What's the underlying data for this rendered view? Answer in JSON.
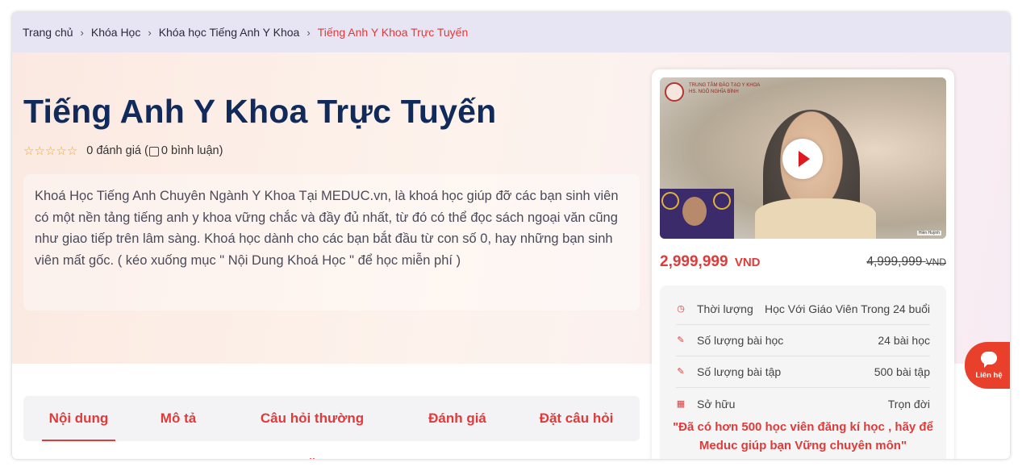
{
  "breadcrumb": {
    "home": "Trang chủ",
    "courses": "Khóa Học",
    "category": "Khóa học Tiếng Anh Y Khoa",
    "current": "Tiếng Anh Y Khoa Trực Tuyến",
    "separator": "›"
  },
  "course": {
    "title": "Tiếng Anh Y Khoa Trực Tuyến",
    "stars": 0,
    "rating_text": "0 đánh giá (",
    "comment_text": "0 bình luận)",
    "description": "Khoá Học Tiếng Anh Chuyên Ngành Y Khoa Tại MEDUC.vn, là khoá học giúp đỡ các bạn sinh viên có một nền tảng tiếng anh y khoa vững chắc và đầy đủ nhất, từ đó có thể đọc sách ngoại văn cũng như giao tiếp trên lâm sàng. Khoá học dành cho các bạn bắt đầu từ con số 0, hay những bạn sinh viên mất gốc. ( kéo xuống mục \" Nội Dung Khoá Học \" để học miễn phí )"
  },
  "tabs": [
    {
      "label": "Nội dung",
      "active": true
    },
    {
      "label": "Mô tả",
      "active": false
    },
    {
      "label": "Câu hỏi thường gặp",
      "active": false
    },
    {
      "label": "Đánh giá",
      "active": false
    },
    {
      "label": "Đặt câu hỏi",
      "active": false
    }
  ],
  "side": {
    "video_logo_text": "TRUNG TÂM ĐÀO TẠO Y KHOA HS. NGÔ NGHĨA BÌNH",
    "video_tag": "Hiền Huỳnh",
    "price": "2,999,999",
    "price_unit": "VND",
    "old_price": "4,999,999",
    "old_price_unit": "VND",
    "info": [
      {
        "icon": "clock-icon",
        "label": "Thời lượng",
        "value": "Học Với Giáo Viên Trong 24 buổi"
      },
      {
        "icon": "edit-icon",
        "label": "Số lượng bài học",
        "value": "24 bài học"
      },
      {
        "icon": "edit-icon",
        "label": "Số lượng bài tập",
        "value": "500 bài tập"
      },
      {
        "icon": "calendar-icon",
        "label": "Sở hữu",
        "value": "Trọn đời"
      }
    ],
    "promo_line1": "\"Đã có hơn 500 học viên đăng kí học , hãy để",
    "promo_line2": "Meduc giúp bạn Vững chuyên môn\""
  },
  "contact": {
    "label": "Liên hệ"
  },
  "colors": {
    "accent": "#e03a3a",
    "title": "#102a5c",
    "breadcrumb_bg": "#e7e4f3",
    "contact_bg": "#e8402a"
  }
}
